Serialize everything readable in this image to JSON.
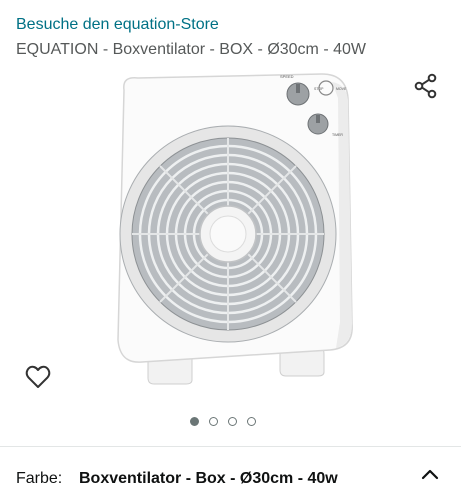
{
  "store": {
    "link_text": "Besuche den equation-Store"
  },
  "product": {
    "title": "EQUATION - Boxventilator - BOX - Ø30cm - 40W"
  },
  "image": {
    "fan_labels": {
      "speed": "SPEED",
      "stop": "STOP",
      "move": "MOVE",
      "timer": "TIMER"
    }
  },
  "icons": {
    "share": "share-icon",
    "wishlist": "heart-outline-icon",
    "expand": "chevron-up-icon"
  },
  "carousel": {
    "total": 4,
    "active_index": 1
  },
  "variant": {
    "label": "Farbe:",
    "value": "Boxventilator - Box - Ø30cm - 40w"
  },
  "colors": {
    "link": "#007185",
    "title": "#565959",
    "text": "#0f1111",
    "dot": "#6b7676"
  }
}
